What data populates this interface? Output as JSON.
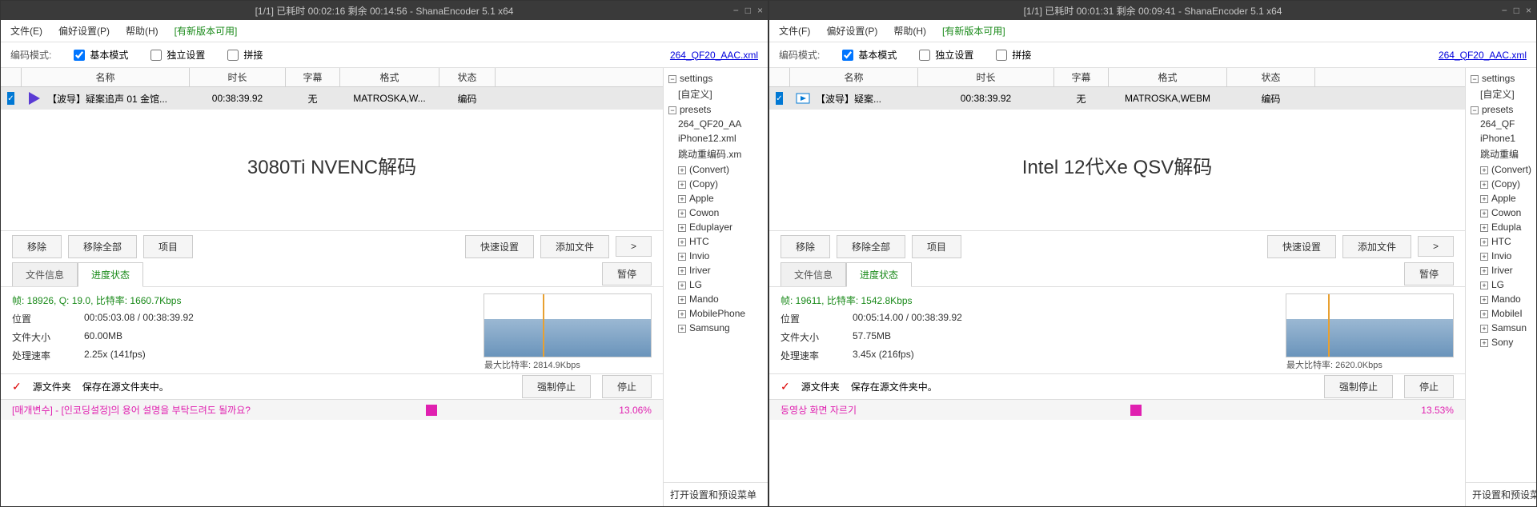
{
  "left": {
    "title": "[1/1] 已耗时 00:02:16 剩余 00:14:56 - ShanaEncoder 5.1 x64",
    "overlay": "3080Ti NVENC解码",
    "preset_link": "264_QF20_AAC.xml",
    "row": {
      "name": "【波导】疑案追声 01 金馆...",
      "dur": "00:38:39.92",
      "sub": "无",
      "fmt": "MATROSKA,W...",
      "status": "编码"
    },
    "stat_green": "帧: 18926, Q: 19.0, 比特率: 1660.7Kbps",
    "pos": "00:05:03.08 / 00:38:39.92",
    "size": "60.00MB",
    "speed": "2.25x (141fps)",
    "max_bitrate": "最大比特率: 2814.9Kbps",
    "status_text": "[매개변수] - [인코딩설정]의 용어 설명을 부탁드려도 될까요?",
    "status_pct": "13.06%"
  },
  "right": {
    "title": "[1/1] 已耗时 00:01:31 剩余 00:09:41 - ShanaEncoder 5.1 x64",
    "overlay": "Intel 12代Xe QSV解码",
    "preset_link": "264_QF20_AAC.xml",
    "row": {
      "name": "【波导】疑案...",
      "dur": "00:38:39.92",
      "sub": "无",
      "fmt": "MATROSKA,WEBM",
      "status": "编码"
    },
    "stat_green": "帧: 19611, 比特率: 1542.8Kbps",
    "pos": "00:05:14.00 / 00:38:39.92",
    "size": "57.75MB",
    "speed": "3.45x (216fps)",
    "max_bitrate": "最大比特率: 2620.0Kbps",
    "status_text": "동영상 화면 자르기",
    "status_pct": "13.53%"
  },
  "common": {
    "menu": {
      "file": "文件(F)",
      "file_l": "文件(E)",
      "pref": "偏好设置(P)",
      "help": "帮助(H)",
      "update": "[有新版本可用]"
    },
    "mode": {
      "label": "编码模式:",
      "basic": "基本模式",
      "indep": "独立设置",
      "concat": "拼接"
    },
    "cols": {
      "name": "名称",
      "dur": "时长",
      "sub": "字幕",
      "fmt": "格式",
      "status": "状态"
    },
    "btns": {
      "remove": "移除",
      "removeall": "移除全部",
      "project": "项目",
      "quickset": "快速设置",
      "addfile": "添加文件",
      "arrow": ">"
    },
    "tabs": {
      "fileinfo": "文件信息",
      "progress": "进度状态",
      "pause": "暂停"
    },
    "stats": {
      "pos": "位置",
      "size": "文件大小",
      "speed": "处理速率"
    },
    "save": {
      "label": "源文件夹",
      "desc": "保存在源文件夹中。",
      "force": "强制停止",
      "stop": "停止"
    },
    "open_settings": "打开设置和预设菜单",
    "open_settings_r": "开设置和预设菜单",
    "tree": {
      "settings": "settings",
      "custom": "[自定义]",
      "presets": "presets",
      "p1": "264_QF20_AA",
      "p1r": "264_QF",
      "p2": "iPhone12.xml",
      "p2r": "iPhone1",
      "p3": "跳动重编码.xm",
      "p3r": "跳动重编",
      "convert": "(Convert)",
      "copy": "(Copy)",
      "apple": "Apple",
      "cowon": "Cowon",
      "edu": "Eduplayer",
      "edur": "Edupla",
      "htc": "HTC",
      "invio": "Invio",
      "iriver": "Iriver",
      "lg": "LG",
      "mando": "Mando",
      "mobile": "MobilePhone",
      "mobiler": "MobileI",
      "samsung": "Samsung",
      "samsungr": "Samsun",
      "sony": "Sony"
    }
  }
}
